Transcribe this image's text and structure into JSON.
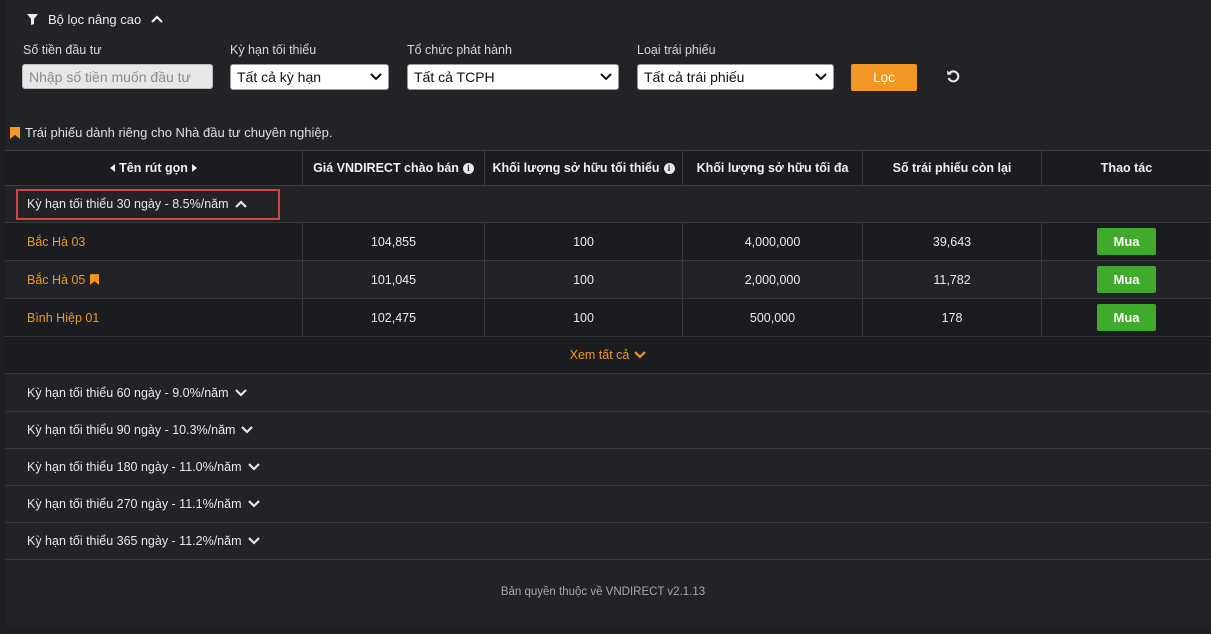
{
  "filter": {
    "title": "Bộ lọc nâng cao",
    "amount_label": "Số tiền đầu tư",
    "amount_placeholder": "Nhập số tiền muốn đầu tư",
    "term_label": "Kỳ hạn tối thiểu",
    "term_value": "Tất cả kỳ hạn",
    "issuer_label": "Tổ chức phát hành",
    "issuer_value": "Tất cả TCPH",
    "type_label": "Loại trái phiếu",
    "type_value": "Tất cả trái phiếu",
    "filter_button": "Lọc"
  },
  "note": "Trái phiếu dành riêng cho Nhà đầu tư chuyên nghiệp.",
  "table": {
    "headers": {
      "name": "Tên rút gọn",
      "price": "Giá VNDIRECT chào bán",
      "min_qty": "Khối lượng sở hữu tối thiểu",
      "max_qty": "Khối lượng sở hữu tối đa",
      "remaining": "Số trái phiếu còn lại",
      "action": "Thao tác"
    },
    "active_group": "Kỳ hạn tối thiểu 30 ngày - 8.5%/năm",
    "rows": [
      {
        "name": "Bắc Hà 03",
        "price": "104,855",
        "min_qty": "100",
        "max_qty": "4,000,000",
        "remaining": "39,643",
        "action": "Mua"
      },
      {
        "name": "Bắc Hà 05",
        "price": "101,045",
        "min_qty": "100",
        "max_qty": "2,000,000",
        "remaining": "11,782",
        "action": "Mua"
      },
      {
        "name": "Bình Hiệp 01",
        "price": "102,475",
        "min_qty": "100",
        "max_qty": "500,000",
        "remaining": "178",
        "action": "Mua"
      }
    ],
    "see_all": "Xem tất cả",
    "groups": [
      "Kỳ hạn tối thiểu 60 ngày - 9.0%/năm",
      "Kỳ hạn tối thiểu 90 ngày - 10.3%/năm",
      "Kỳ hạn tối thiểu 180 ngày - 11.0%/năm",
      "Kỳ hạn tối thiểu 270 ngày - 11.1%/năm",
      "Kỳ hạn tối thiểu 365 ngày - 11.2%/năm"
    ]
  },
  "footer": "Bản quyền thuộc về VNDIRECT v2.1.13",
  "colors": {
    "accent": "#f29723",
    "buy": "#3faa2c",
    "highlight": "#d64545"
  }
}
